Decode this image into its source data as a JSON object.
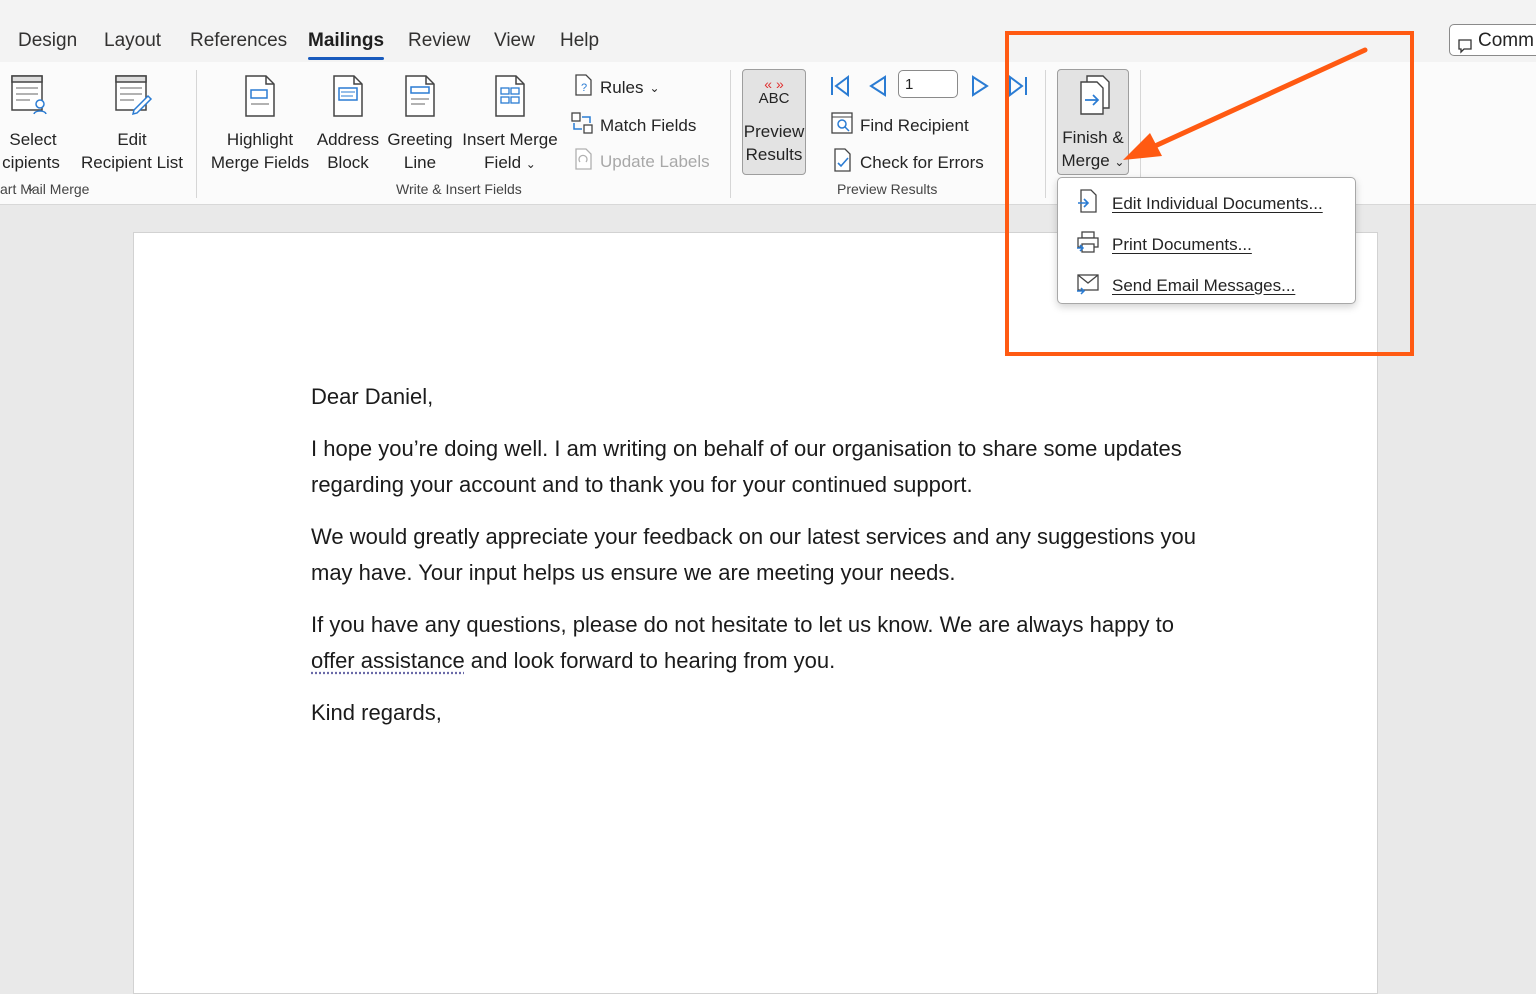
{
  "tabs": [
    "Design",
    "Layout",
    "References",
    "Mailings",
    "Review",
    "View",
    "Help"
  ],
  "active_tab": "Mailings",
  "comments_label": "Comm",
  "ribbon": {
    "start_group": {
      "select_line1": "Select",
      "select_line2": "cipients",
      "edit_line1": "Edit",
      "edit_line2": "Recipient List",
      "label": "art Mail Merge"
    },
    "write_group": {
      "highlight_line1": "Highlight",
      "highlight_line2": "Merge Fields",
      "address_line1": "Address",
      "address_line2": "Block",
      "greeting_line1": "Greeting",
      "greeting_line2": "Line",
      "insert_line1": "Insert Merge",
      "insert_line2": "Field",
      "rules": "Rules",
      "match_fields": "Match Fields",
      "update_labels": "Update Labels",
      "label": "Write & Insert Fields"
    },
    "preview_group": {
      "abc": "ABC",
      "preview_line1": "Preview",
      "preview_line2": "Results",
      "record_value": "1",
      "find_recipient": "Find Recipient",
      "check_errors": "Check for Errors",
      "label": "Preview Results"
    },
    "finish_group": {
      "finish_line1": "Finish &",
      "finish_line2": "Merge"
    }
  },
  "menu": {
    "items": [
      "Edit Individual Documents...",
      "Print Documents...",
      "Send Email Messages..."
    ]
  },
  "document": {
    "greeting": "Dear Daniel,",
    "p1": "I hope you’re doing well. I am writing on behalf of our organisation to share some updates regarding your account and to thank you for your continued support.",
    "p2": "We would greatly appreciate your feedback on our latest services and any suggestions you may have. Your input helps us ensure we are meeting your needs.",
    "p3_before": "If you have any questions, please do not hesitate to let us know. We are always happy to ",
    "p3_flag": "offer assistance",
    "p3_after": " and look forward to hearing from you.",
    "closing": "Kind regards,"
  },
  "colors": {
    "accent_blue": "#185abd",
    "annotation_orange": "#ff5a12",
    "nav_blue": "#2b7cd3"
  }
}
